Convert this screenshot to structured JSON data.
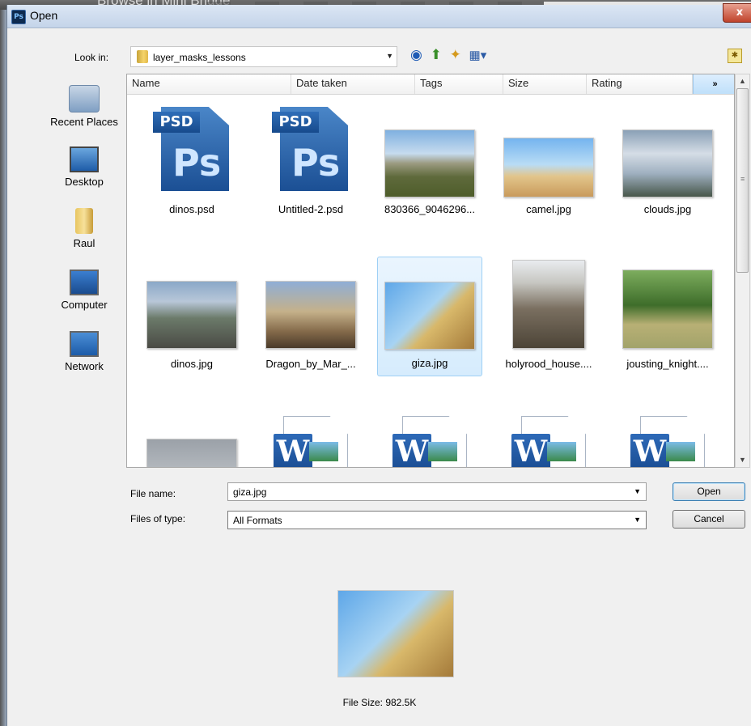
{
  "background": {
    "ghost_text": "Browse in Mini Bridge"
  },
  "window": {
    "title": "Open",
    "app_icon": "Ps",
    "close_glyph": "x"
  },
  "lookin": {
    "label": "Look in:",
    "value": "layer_masks_lessons"
  },
  "places": [
    {
      "label": "Recent Places",
      "icon": "recent-places-icon"
    },
    {
      "label": "Desktop",
      "icon": "desktop-icon"
    },
    {
      "label": "Raul",
      "icon": "user-folder-icon"
    },
    {
      "label": "Computer",
      "icon": "computer-icon"
    },
    {
      "label": "Network",
      "icon": "network-icon"
    }
  ],
  "columns": [
    "Name",
    "Date taken",
    "Tags",
    "Size",
    "Rating"
  ],
  "more_columns": "»",
  "files": [
    {
      "name": "dinos.psd",
      "kind": "psd"
    },
    {
      "name": "Untitled-2.psd",
      "kind": "psd"
    },
    {
      "name": "830366_9046296...",
      "kind": "img-mtn"
    },
    {
      "name": "camel.jpg",
      "kind": "img-camel"
    },
    {
      "name": "clouds.jpg",
      "kind": "img-clouds"
    },
    {
      "name": "dinos.jpg",
      "kind": "img-dinos"
    },
    {
      "name": "Dragon_by_Mar_...",
      "kind": "img-dragon"
    },
    {
      "name": "giza.jpg",
      "kind": "img-giza",
      "selected": true
    },
    {
      "name": "holyrood_house....",
      "kind": "img-holy"
    },
    {
      "name": "jousting_knight....",
      "kind": "img-joust"
    }
  ],
  "file_name": {
    "label": "File name:",
    "value": "giza.jpg"
  },
  "file_type": {
    "label": "Files of type:",
    "value": "All Formats"
  },
  "buttons": {
    "open": "Open",
    "cancel": "Cancel"
  },
  "preview": {
    "file_size": "File Size: 982.5K"
  },
  "icons": {
    "psd_tag": "PSD",
    "psd_letter": "Ps",
    "word_letter": "W",
    "dropdown": "▼",
    "scroll_up": "▲",
    "scroll_down": "▼",
    "grip": "≡",
    "back": "◉",
    "up": "⬆",
    "new_folder": "✦",
    "views": "▦▾",
    "corner": "✱"
  }
}
